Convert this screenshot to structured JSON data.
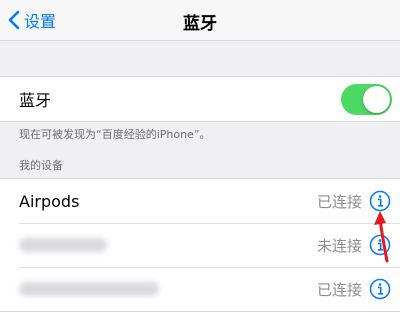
{
  "nav": {
    "back_label": "设置",
    "title": "蓝牙"
  },
  "bluetooth": {
    "label": "蓝牙",
    "enabled": true,
    "accent": "#4cd964"
  },
  "discoverable_note": "现在可被发现为“百度经验的iPhone”。",
  "section_header": "我的设备",
  "devices": [
    {
      "name": "Airpods",
      "status": "已连接",
      "icon": "info-icon"
    },
    {
      "name": "",
      "status": "未连接",
      "icon": "info-icon"
    },
    {
      "name": "",
      "status": "已连接",
      "icon": "info-icon"
    }
  ],
  "colors": {
    "link": "#007aff",
    "annotation_arrow": "#e8171d"
  }
}
